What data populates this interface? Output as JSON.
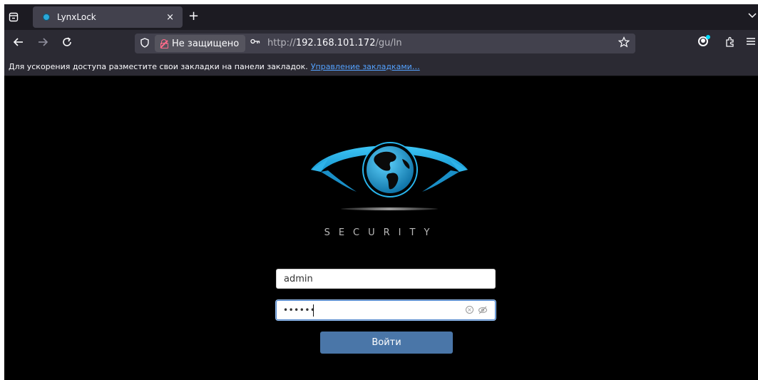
{
  "browser": {
    "tab": {
      "title": "LynxLock",
      "close_glyph": "×"
    },
    "new_tab_glyph": "+",
    "navigation": {
      "back_icon": "arrow-left-icon",
      "forward_icon": "arrow-right-icon",
      "reload_icon": "reload-icon"
    },
    "urlbar": {
      "security_label": "Не защищено",
      "url_prefix": "http://",
      "url_host": "192.168.101.172",
      "url_path": "/gu/ln"
    },
    "bookmarks_bar": {
      "message": "Для ускорения доступа разместите свои закладки на панели закладок.",
      "link": "Управление закладками…"
    },
    "colors": {
      "accent_link": "#54a2ff",
      "insecure_lock": "#ff6b8a",
      "account_badge": "#00ddff"
    }
  },
  "login_page": {
    "brand": "SECURITY",
    "logo_icon": "eye-globe-logo",
    "username": {
      "value": "admin"
    },
    "password": {
      "masked_value": "••••••",
      "clear_icon": "clear-icon",
      "visibility_icon": "eye-off-icon"
    },
    "submit_label": "Войти",
    "colors": {
      "background": "#000000",
      "button": "#4a76a8",
      "logo_blue": "#29b6ee"
    }
  }
}
